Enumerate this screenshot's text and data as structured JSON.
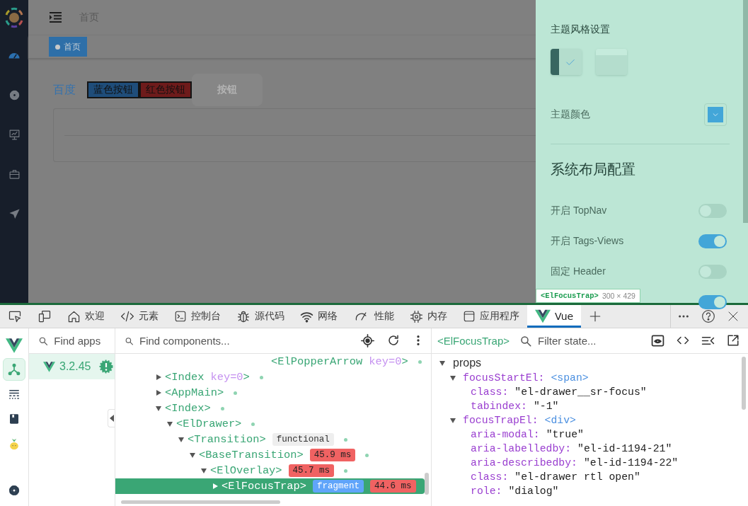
{
  "app": {
    "sidebar_menu": [
      {
        "kind": "dashboard",
        "selected": true
      },
      {
        "kind": "gear",
        "selected": false
      },
      {
        "kind": "monitor",
        "selected": false
      },
      {
        "kind": "briefcase",
        "selected": false
      },
      {
        "kind": "send",
        "selected": false
      }
    ],
    "breadcrumb": "首页",
    "tags": [
      {
        "label": "首页",
        "selected": true
      }
    ],
    "link": "百度",
    "buttons": [
      {
        "label": "蓝色按钮",
        "kind": "blue"
      },
      {
        "label": "红色按钮",
        "kind": "red"
      },
      {
        "label": "按钮",
        "kind": "disabled"
      }
    ]
  },
  "drawer": {
    "theme_title": "主题风格设置",
    "themes": [
      {
        "kind": "dark",
        "selected": true
      },
      {
        "kind": "light",
        "selected": false
      }
    ],
    "color_label": "主题颜色",
    "color": "#43a6d8",
    "layout_title": "系统布局配置",
    "switches": [
      {
        "label": "开启 TopNav",
        "on": false
      },
      {
        "label": "开启 Tags-Views",
        "on": true
      },
      {
        "label": "固定 Header",
        "on": false
      },
      {
        "on": true
      }
    ],
    "inspect_tooltip": {
      "component": "<ElFocusTrap>",
      "size": "300 × 429"
    }
  },
  "devtools": {
    "tabs": [
      {
        "kind": "inspect",
        "selected": false
      },
      {
        "kind": "device",
        "selected": false
      },
      {
        "kind": "home",
        "label": "欢迎",
        "selected": false
      },
      {
        "kind": "code",
        "label": "元素",
        "selected": false
      },
      {
        "kind": "console",
        "label": "控制台",
        "selected": false
      },
      {
        "kind": "bug",
        "label": "源代码",
        "selected": false
      },
      {
        "kind": "wifi",
        "label": "网络",
        "selected": false
      },
      {
        "kind": "gauge",
        "label": "性能",
        "selected": false
      },
      {
        "kind": "chip",
        "label": "内存",
        "selected": false
      },
      {
        "kind": "window",
        "label": "应用程序",
        "selected": false
      },
      {
        "kind": "vue",
        "label": "Vue",
        "selected": true
      },
      {
        "kind": "add",
        "selected": false
      }
    ],
    "rail": [
      {
        "kind": "components",
        "selected": true
      },
      {
        "kind": "timeline",
        "selected": false
      },
      {
        "kind": "docs",
        "selected": false
      },
      {
        "kind": "pinia",
        "selected": false
      }
    ],
    "apps_search": {
      "placeholder": "Find apps"
    },
    "apps": [
      {
        "version": "3.2.45",
        "selected": true
      }
    ],
    "components_search": {
      "placeholder": "Find components..."
    },
    "tree": {
      "partial_row": {
        "tag": "<ElPopperArrow",
        "attr": "key=0",
        "end": ">"
      },
      "nodes": [
        {
          "tag": "<Index",
          "attr": "key=0",
          "end": ">",
          "expanded": false,
          "selected": false
        },
        {
          "tag": "<AppMain>",
          "expanded": false,
          "selected": false
        },
        {
          "tag": "<Index>",
          "expanded": true,
          "selected": false,
          "children": [
            {
              "tag": "<ElDrawer>",
              "expanded": true,
              "selected": false,
              "children": [
                {
                  "tag": "<Transition>",
                  "expanded": true,
                  "selected": false,
                  "badges": [
                    {
                      "text": "functional",
                      "kind": "functional"
                    }
                  ],
                  "children": [
                    {
                      "tag": "<BaseTransition>",
                      "expanded": true,
                      "selected": false,
                      "badges": [
                        {
                          "text": "45.9 ms",
                          "kind": "time"
                        }
                      ],
                      "children": [
                        {
                          "tag": "<ElOverlay>",
                          "expanded": true,
                          "selected": false,
                          "badges": [
                            {
                              "text": "45.7 ms",
                              "kind": "time"
                            }
                          ],
                          "children": [
                            {
                              "tag": "<ElFocusTrap>",
                              "expanded": false,
                              "selected": true,
                              "badges": [
                                {
                                  "text": "fragment",
                                  "kind": "fragment"
                                },
                                {
                                  "text": "44.6 ms",
                                  "kind": "time"
                                }
                              ]
                            }
                          ]
                        }
                      ]
                    }
                  ]
                }
              ]
            }
          ]
        }
      ]
    },
    "inspector": {
      "component": "<ElFocusTrap>",
      "filter": {
        "placeholder": "Filter state..."
      },
      "sections": [
        {
          "title": "props",
          "expanded": true,
          "children": [
            {
              "key": "focusStartEl:",
              "value": "<span>",
              "kind": "element",
              "expanded": true,
              "children": [
                {
                  "key": "class:",
                  "value": "\"el-drawer__sr-focus\"",
                  "kind": "string"
                },
                {
                  "key": "tabindex:",
                  "value": "\"-1\"",
                  "kind": "string"
                }
              ]
            },
            {
              "key": "focusTrapEl:",
              "value": "<div>",
              "kind": "element",
              "expanded": true,
              "children": [
                {
                  "key": "aria-modal:",
                  "value": "\"true\"",
                  "kind": "string"
                },
                {
                  "key": "aria-labelledby:",
                  "value": "\"el-id-1194-21\"",
                  "kind": "string"
                },
                {
                  "key": "aria-describedby:",
                  "value": "\"el-id-1194-22\"",
                  "kind": "string"
                },
                {
                  "key": "class:",
                  "value": "\"el-drawer rtl open\"",
                  "kind": "string"
                },
                {
                  "key": "role:",
                  "value": "\"dialog\"",
                  "kind": "string"
                }
              ]
            }
          ]
        }
      ]
    }
  }
}
